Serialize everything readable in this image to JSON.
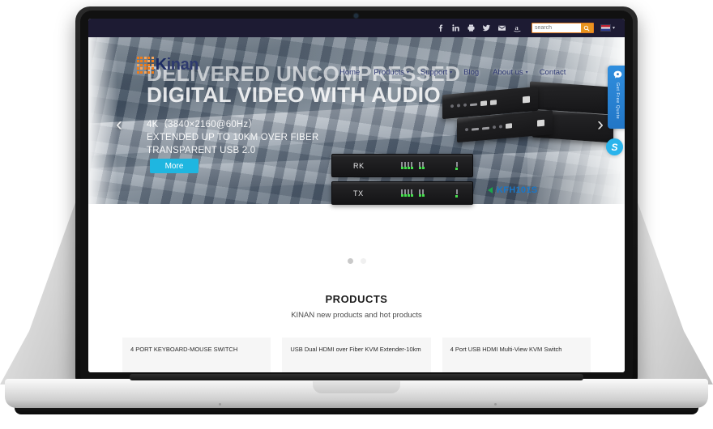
{
  "topbar": {
    "social": [
      {
        "name": "facebook-icon",
        "glyph": "f"
      },
      {
        "name": "linkedin-icon",
        "glyph": "in"
      },
      {
        "name": "printer-icon",
        "glyph": "⎙"
      },
      {
        "name": "twitter-icon",
        "glyph": "✉"
      },
      {
        "name": "email-icon",
        "glyph": "✉"
      },
      {
        "name": "amazon-icon",
        "glyph": "a"
      }
    ],
    "search_placeholder": "search",
    "search_value": "",
    "search_button_label": "Search",
    "language": "English"
  },
  "brand": {
    "name_k": "K",
    "name_rest": "inan",
    "full": "Kinan"
  },
  "nav": [
    {
      "label": "Home",
      "caret": ""
    },
    {
      "label": "Products",
      "caret": "▾"
    },
    {
      "label": "Support",
      "caret": "▾"
    },
    {
      "label": "Blog",
      "caret": ""
    },
    {
      "label": "About us",
      "caret": "▾"
    },
    {
      "label": "Contact",
      "caret": ""
    }
  ],
  "hero": {
    "headline_line1": "DELIVERED UNCOMPRESSED",
    "headline_line2": "DIGITAL VIDEO WITH AUDIO",
    "bullets": [
      "4K（3840×2160@60Hz）",
      "EXTENDED UP TO 10KM OVER FIBER",
      "TRANSPARENT USB 2.0"
    ],
    "more_button": "More",
    "prev_arrow": "‹",
    "next_arrow": "›",
    "panel_rx_label": "RK",
    "panel_tx_label": "TX",
    "product_code": "KFH101S",
    "dots": [
      {
        "active": true
      },
      {
        "active": false
      }
    ]
  },
  "products": {
    "title": "PRODUCTS",
    "subtitle": "KINAN new products and hot products",
    "cards": [
      {
        "name": "4 PORT KEYBOARD-MOUSE SWITCH"
      },
      {
        "name": "USB Dual HDMI over Fiber KVM Extender-10km"
      },
      {
        "name": "4 Port USB HDMI Multi-View KVM Switch"
      }
    ]
  },
  "floating": {
    "chat_label": "Get Free Quote",
    "skype_glyph": "S"
  },
  "colors": {
    "topbar_bg": "#1d1b33",
    "accent_orange": "#f07d1a",
    "nav_blue": "#2a3570",
    "button_cyan": "#1fb6e0",
    "product_code_blue": "#1877c9",
    "triangle_green": "#1aa84a",
    "chat_blue": "#2276c6",
    "skype_blue": "#2ab4ec"
  }
}
